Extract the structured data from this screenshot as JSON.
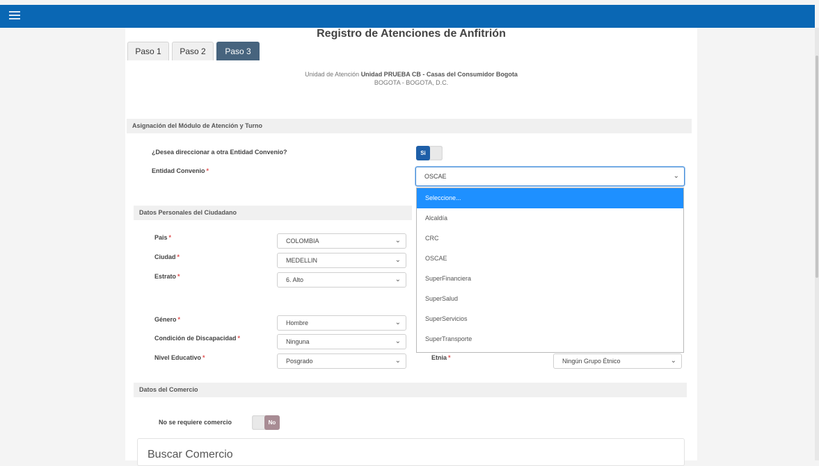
{
  "title": "Registro de Atenciones de Anfitrión",
  "tabs": [
    {
      "label": "Paso 1"
    },
    {
      "label": "Paso 2"
    },
    {
      "label": "Paso 3"
    }
  ],
  "unit": {
    "prefix": "Unidad de Atención",
    "name": "Unidad PRUEBA CB - Casas del Consumidor Bogota",
    "location": "BOGOTA - BOGOTA, D.C."
  },
  "asignacion": {
    "header": "Asignación del Módulo de Atención y Turno",
    "direccionar_label": "¿Desea direccionar a otra Entidad Convenio?",
    "direccionar_toggle": "Si",
    "entidad_label": "Entidad Convenio",
    "required_mark": "*",
    "entidad_value": "OSCAE"
  },
  "dropdown": {
    "options": [
      "Seleccione...",
      "Alcaldía",
      "CRC",
      "OSCAE",
      "SuperFinanciera",
      "SuperSalud",
      "SuperServicios",
      "SuperTransporte"
    ],
    "highlighted_index": 0
  },
  "datos_personales": {
    "header": "Datos Personales del Ciudadano",
    "pais_label": "Pais",
    "pais_value": "COLOMBIA",
    "ciudad_label": "Ciudad",
    "ciudad_value": "MEDELLIN",
    "estrato_label": "Estrato",
    "estrato_value": "6. Alto",
    "genero_label": "Género",
    "genero_value": "Hombre",
    "discapacidad_label": "Condición de Discapacidad",
    "discapacidad_value": "Ninguna",
    "nivel_label": "Nivel Educativo",
    "nivel_value": "Posgrado",
    "etnia_label": "Etnia",
    "etnia_value": "Ningún Grupo Étnico"
  },
  "comercio": {
    "header": "Datos del Comercio",
    "no_requiere_label": "No se requiere comercio",
    "no_requiere_toggle": "No",
    "buscar_title": "Buscar Comercio"
  },
  "icons": {
    "menu": "hamburger-menu-icon",
    "chevron": "chevron-down-icon"
  },
  "colors": {
    "topbar": "#0a67b4",
    "active_tab": "#47647e",
    "toggle_yes": "#1e5fa8",
    "dropdown_highlight": "#1e90ff"
  }
}
